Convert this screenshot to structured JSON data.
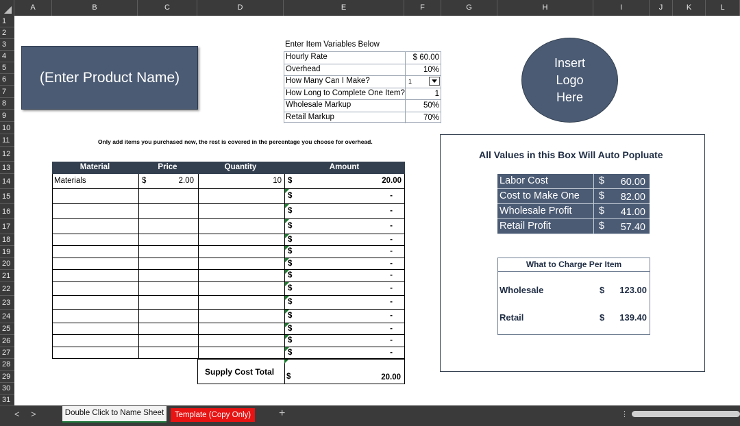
{
  "columns": [
    "A",
    "B",
    "C",
    "D",
    "E",
    "F",
    "G",
    "H",
    "I",
    "J",
    "K",
    "L"
  ],
  "rows": [
    "1",
    "2",
    "3",
    "4",
    "5",
    "6",
    "7",
    "8",
    "9",
    "10",
    "11",
    "12",
    "13",
    "14",
    "15",
    "16",
    "17",
    "18",
    "19",
    "20",
    "21",
    "22",
    "23",
    "24",
    "25",
    "26",
    "27",
    "28",
    "29",
    "30",
    "31"
  ],
  "product_name": "(Enter Product  Name)",
  "variables": {
    "title": "Enter Item Variables Below",
    "items": [
      {
        "label": "Hourly Rate",
        "value": "$ 60.00"
      },
      {
        "label": "Overhead",
        "value": "10%"
      },
      {
        "label": "How Many Can I Make?",
        "value": "1"
      },
      {
        "label": "How Long to Complete One Item?",
        "value": "1"
      },
      {
        "label": "Wholesale Markup",
        "value": "50%"
      },
      {
        "label": "Retail Markup",
        "value": "70%"
      }
    ]
  },
  "logo_text": {
    "line1": "Insert",
    "line2": "Logo",
    "line3": "Here"
  },
  "note": "Only add items you purchased new, the rest is covered in the percentage you choose for overhead.",
  "materials": {
    "headers": {
      "material": "Material",
      "price": "Price",
      "quantity": "Quantity",
      "amount": "Amount"
    },
    "first_row": {
      "material": "Materials",
      "price_sign": "$",
      "price": "2.00",
      "quantity": "10",
      "amount_sign": "$",
      "amount": "20.00"
    },
    "empty_amount_sign": "$",
    "empty_amount": "-",
    "total_label": "Supply Cost Total",
    "total_sign": "$",
    "total": "20.00"
  },
  "auto": {
    "title": "All Values in this Box Will Auto Popluate",
    "summary": [
      {
        "label": "Labor Cost",
        "sign": "$",
        "value": "60.00"
      },
      {
        "label": "Cost to Make One",
        "sign": "$",
        "value": "82.00"
      },
      {
        "label": "Wholesale Profit",
        "sign": "$",
        "value": "41.00"
      },
      {
        "label": "Retail Profit",
        "sign": "$",
        "value": "57.40"
      }
    ],
    "charge": {
      "title": "What to Charge Per Item",
      "wholesale_label": "Wholesale",
      "wholesale_sign": "$",
      "wholesale": "123.00",
      "retail_label": "Retail",
      "retail_sign": "$",
      "retail": "139.40"
    }
  },
  "tabs": {
    "sheet1": "Double Click to Name Sheet",
    "sheet2": "Template (Copy Only)",
    "add": "+",
    "prev": "<",
    "next": ">",
    "dots": "⋮"
  },
  "colors": {
    "header_dark": "#333f4f",
    "slate": "#4b5b74",
    "tab_red": "#e81313"
  }
}
